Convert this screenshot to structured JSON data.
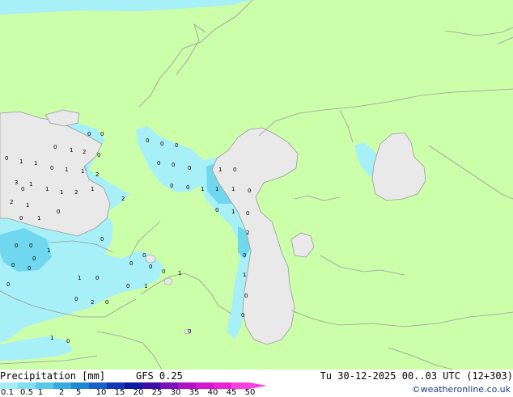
{
  "header": {
    "title": "Precipitation [mm]",
    "model": "GFS 0.25",
    "datetime": "Tu 30-12-2025 00..03 UTC (12+303)",
    "credit": "©weatheronline.co.uk"
  },
  "legend": {
    "ticks": [
      "0.1",
      "0.5",
      "1",
      "2",
      "5",
      "10",
      "15",
      "20",
      "25",
      "30",
      "35",
      "40",
      "45",
      "50"
    ],
    "colors": [
      "#a6eef6",
      "#7fdff0",
      "#55c8ec",
      "#34acdf",
      "#1f86d2",
      "#1761c8",
      "#1238b4",
      "#0e1aa2",
      "#3a10a8",
      "#7a10b8",
      "#b010c8",
      "#d416d0",
      "#ea24d6",
      "#f842e0"
    ]
  },
  "colors": {
    "land": "#ccffaa",
    "water": "#e9e9e9",
    "precip_light": "#a7f0f7",
    "precip_mid": "#6fd8ee",
    "precip_heavy": "#3cbbe6",
    "border": "#9a9a9a"
  },
  "map_values": [
    "0",
    "0",
    "0",
    "1",
    "2",
    "0",
    "0",
    "1",
    "1",
    "0",
    "1",
    "1",
    "2",
    "3",
    "1",
    "1",
    "1",
    "2",
    "0",
    "1",
    "2",
    "1",
    "2",
    "0",
    "0",
    "0",
    "0",
    "0",
    "0",
    "0",
    "1",
    "0",
    "0",
    "0",
    "1",
    "1",
    "1",
    "0",
    "0",
    "1",
    "0",
    "0",
    "1",
    "0",
    "2",
    "0",
    "0",
    "1",
    "0",
    "0",
    "0",
    "0",
    "0",
    "0",
    "0",
    "1",
    "0",
    "1",
    "0",
    "1",
    "0",
    "0",
    "1",
    "0",
    "2",
    "0",
    "0",
    "0",
    "0",
    "1",
    "0"
  ]
}
